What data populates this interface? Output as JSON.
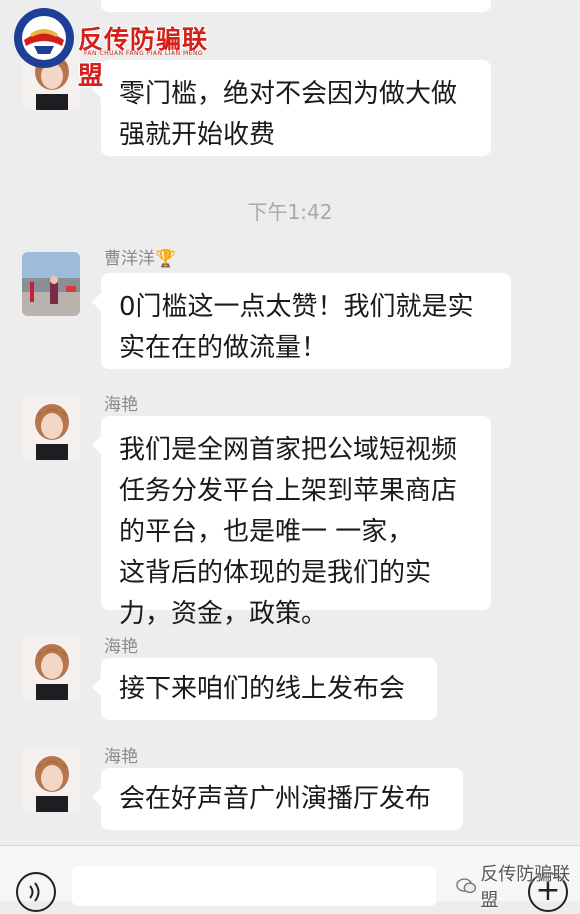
{
  "watermark": {
    "logo_text": "反传防骗联盟",
    "logo_subtext": "FAN CHUAN FANG PIAN LIAN MENG",
    "bottom_text": "反传防骗联盟"
  },
  "messages": [
    {
      "type": "text",
      "sender": "",
      "text": "零门槛，绝对不会因为做大做\n强就开始收费"
    },
    {
      "type": "time",
      "text": "下午1:42"
    },
    {
      "type": "text",
      "sender": "曹洋洋🏆",
      "text": "0门槛这一点太赞！我们就是实\n实在在的做流量！"
    },
    {
      "type": "text",
      "sender": "海艳",
      "text": "我们是全网首家把公域短视频\n任务分发平台上架到苹果商店\n的平台，也是唯一 一家，\n这背后的体现的是我们的实\n力，资金，政策。"
    },
    {
      "type": "text",
      "sender": "海艳",
      "text": "接下来咱们的线上发布会"
    },
    {
      "type": "text",
      "sender": "海艳",
      "text": "会在好声音广州演播厅发布"
    }
  ],
  "input_bar": {
    "voice_icon": "voice-icon",
    "plus_icon": "plus-icon"
  }
}
